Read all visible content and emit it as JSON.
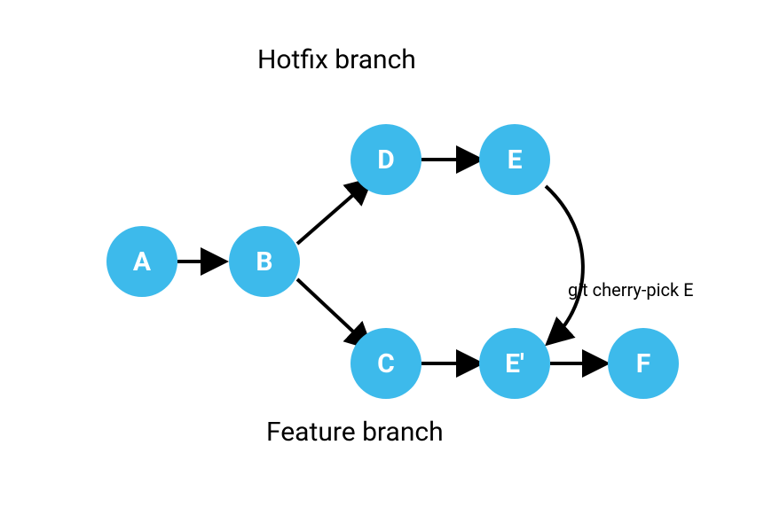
{
  "labels": {
    "top": "Hotfix branch",
    "bottom": "Feature branch",
    "cherry": "git cherry-pick E"
  },
  "nodes": {
    "a": "A",
    "b": "B",
    "c": "C",
    "d": "D",
    "e": "E",
    "ep": "E'",
    "f": "F"
  },
  "colors": {
    "node": "#3dbaeb",
    "arrow": "#000000"
  },
  "diagram": {
    "type": "git-branch-graph",
    "description": "Cherry-pick commit E from Hotfix branch onto Feature branch as E'",
    "branches": [
      {
        "name": "Hotfix branch",
        "commits": [
          "A",
          "B",
          "D",
          "E"
        ]
      },
      {
        "name": "Feature branch",
        "commits": [
          "A",
          "B",
          "C",
          "E'",
          "F"
        ]
      }
    ],
    "edges": [
      {
        "from": "A",
        "to": "B"
      },
      {
        "from": "B",
        "to": "D"
      },
      {
        "from": "B",
        "to": "C"
      },
      {
        "from": "D",
        "to": "E"
      },
      {
        "from": "C",
        "to": "E'"
      },
      {
        "from": "E'",
        "to": "F"
      },
      {
        "from": "E",
        "to": "E'",
        "operation": "git cherry-pick E"
      }
    ]
  }
}
